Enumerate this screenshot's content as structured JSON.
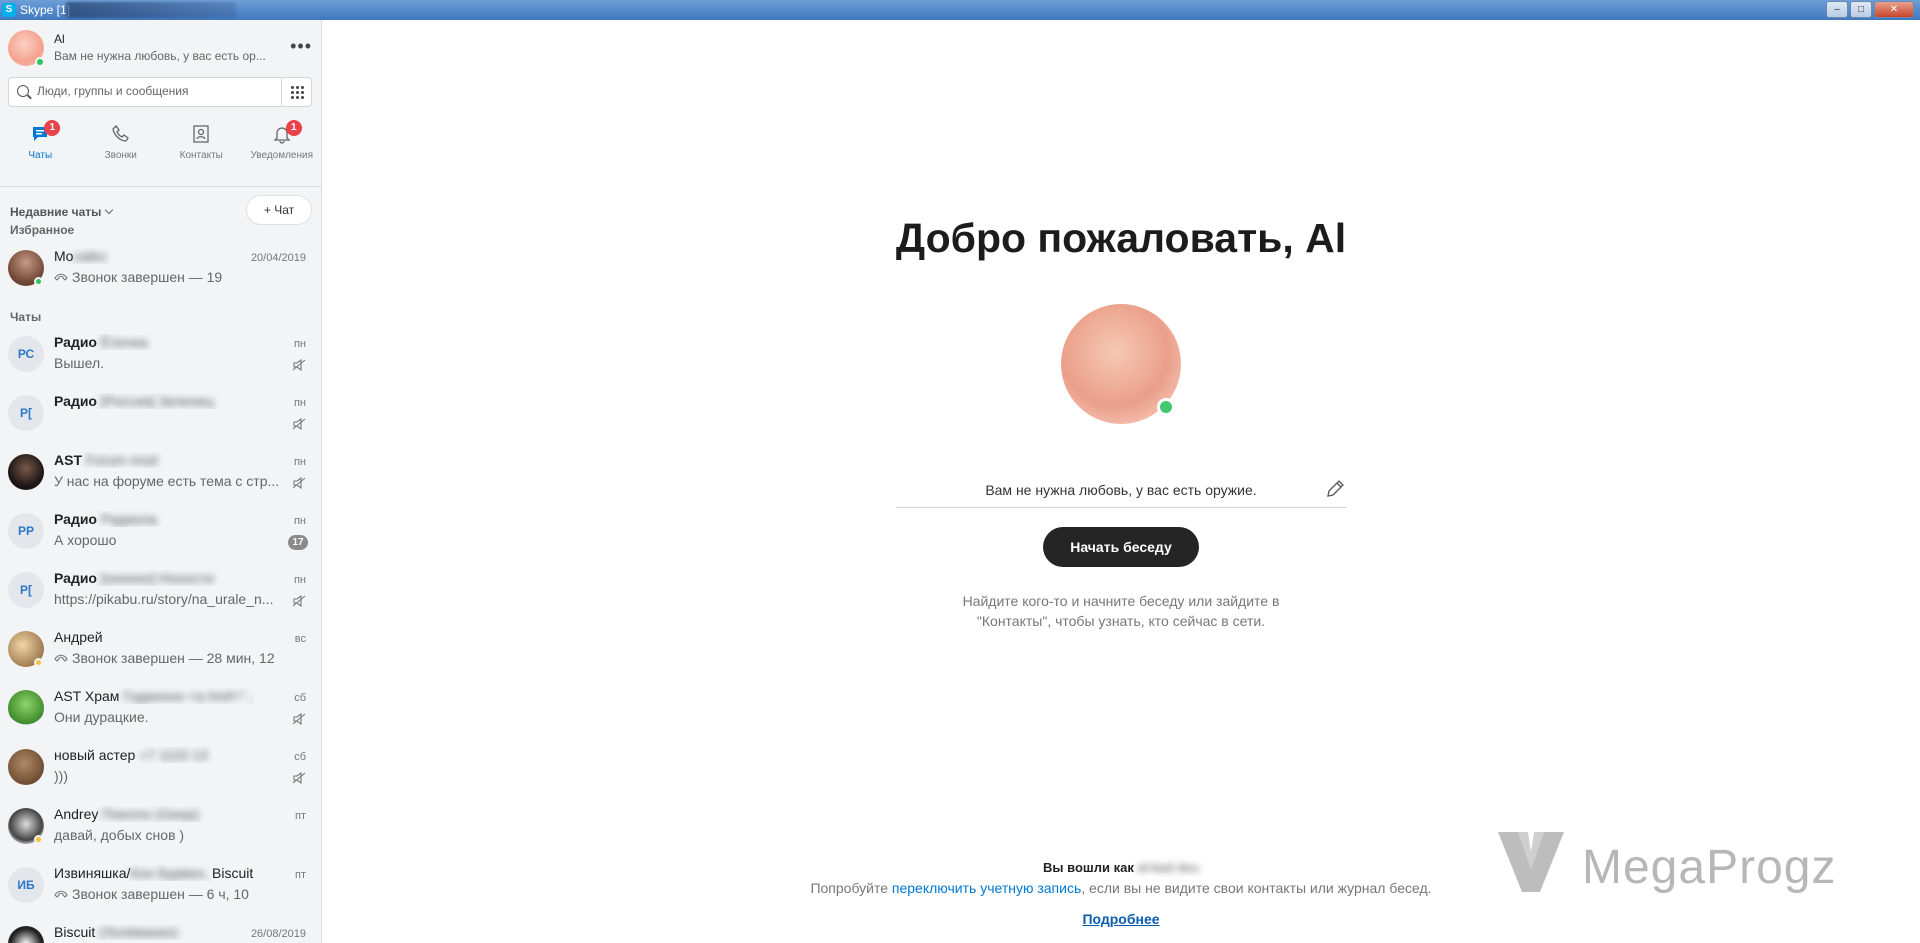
{
  "window": {
    "title": "Skype [1]",
    "buttons": {
      "minimize": "–",
      "maximize": "□",
      "close": "✕"
    }
  },
  "profile": {
    "name": "Al",
    "mood": "Вам не нужна любовь, у вас есть ор..."
  },
  "search": {
    "placeholder": "Люди, группы и сообщения"
  },
  "nav": [
    {
      "label": "Чаты",
      "icon": "chat-icon",
      "badge": "1",
      "active": true
    },
    {
      "label": "Звонки",
      "icon": "phone-icon",
      "badge": "",
      "active": false
    },
    {
      "label": "Контакты",
      "icon": "contacts-icon",
      "badge": "",
      "active": false
    },
    {
      "label": "Уведомления",
      "icon": "bell-icon",
      "badge": "1",
      "active": false
    }
  ],
  "recent_label": "Недавние чаты",
  "new_chat_label": "Чат",
  "sections": {
    "favorites": "Избранное",
    "chats": "Чаты"
  },
  "favorites": [
    {
      "name": "Mo",
      "name_blur": "zaiko",
      "message": "Звонок завершен — 19",
      "date": "20/04/2019",
      "call": true
    }
  ],
  "chats": [
    {
      "name": "Радио",
      "name_blur": "Ёлочка",
      "initials": "РС",
      "message": "Вышел.",
      "date": "пн",
      "bold": true,
      "muted": true
    },
    {
      "name": "Радио",
      "name_blur": "[Россия] Зеленец",
      "initials": "Р[",
      "message": "",
      "date": "пн",
      "bold": true,
      "muted": true
    },
    {
      "name": "AST",
      "name_blur": "Forum mod",
      "initials": "",
      "message": "У нас на форуме есть тема с стр...",
      "date": "пн",
      "bold": true,
      "muted": true
    },
    {
      "name": "Радио",
      "name_blur": "Радиола",
      "initials": "РР",
      "message": "А хорошо",
      "date": "пн",
      "bold": true,
      "unread": "17"
    },
    {
      "name": "Радио",
      "name_blur": "[нннннн] Нооости",
      "initials": "Р[",
      "message": "https://pikabu.ru/story/na_urale_n...",
      "date": "пн",
      "bold": true,
      "muted": true
    },
    {
      "name": "Андрей",
      "name_blur": "",
      "initials": "",
      "message": "Звонок завершен — 28 мин, 12",
      "date": "вс",
      "call": true
    },
    {
      "name": "AST Храм",
      "name_blur": "Годинннн <a href=\"...",
      "initials": "",
      "message": "Они дурацкие.",
      "date": "сб",
      "muted": true
    },
    {
      "name": "новый астер",
      "name_blur": "+7 1115 13",
      "initials": "",
      "message": ")))",
      "date": "сб",
      "muted": true
    },
    {
      "name": "Andrey",
      "name_blur": "Пнелло (Geep)",
      "initials": "",
      "message": "давай, добых снов )",
      "date": "пт"
    },
    {
      "name": "Извиняшка/",
      "name_blur": "Кон Бурвен,",
      "name_tail": " Biscuit...",
      "initials": "ИБ",
      "message": "Звонок завершен — 6 ч, 10",
      "date": "пт",
      "call": true
    },
    {
      "name": "Biscuit",
      "name_blur": "(Лолёванко)",
      "initials": "",
      "message": "",
      "date": "26/08/2019"
    }
  ],
  "main": {
    "welcome": "Добро пожаловать, Al",
    "mood": "Вам не нужна любовь, у вас есть оружие.",
    "start_button": "Начать беседу",
    "hint_line1": "Найдите кого-то и начните беседу или зайдите в",
    "hint_line2": "\"Контакты\", чтобы узнать, кто сейчас в сети.",
    "signed_in_prefix": "Вы вошли как",
    "signed_in_blur": "al-bad dou",
    "switch_prefix": "Попробуйте ",
    "switch_link": "переключить учетную запись",
    "switch_suffix": ", если вы не видите свои контакты или журнал бесед.",
    "more_link": "Подробнее"
  },
  "watermark": "MegaProgz",
  "colors": {
    "accent": "#0078d4",
    "online": "#2ec45f",
    "away": "#f8c140",
    "badge": "#e9424a"
  }
}
